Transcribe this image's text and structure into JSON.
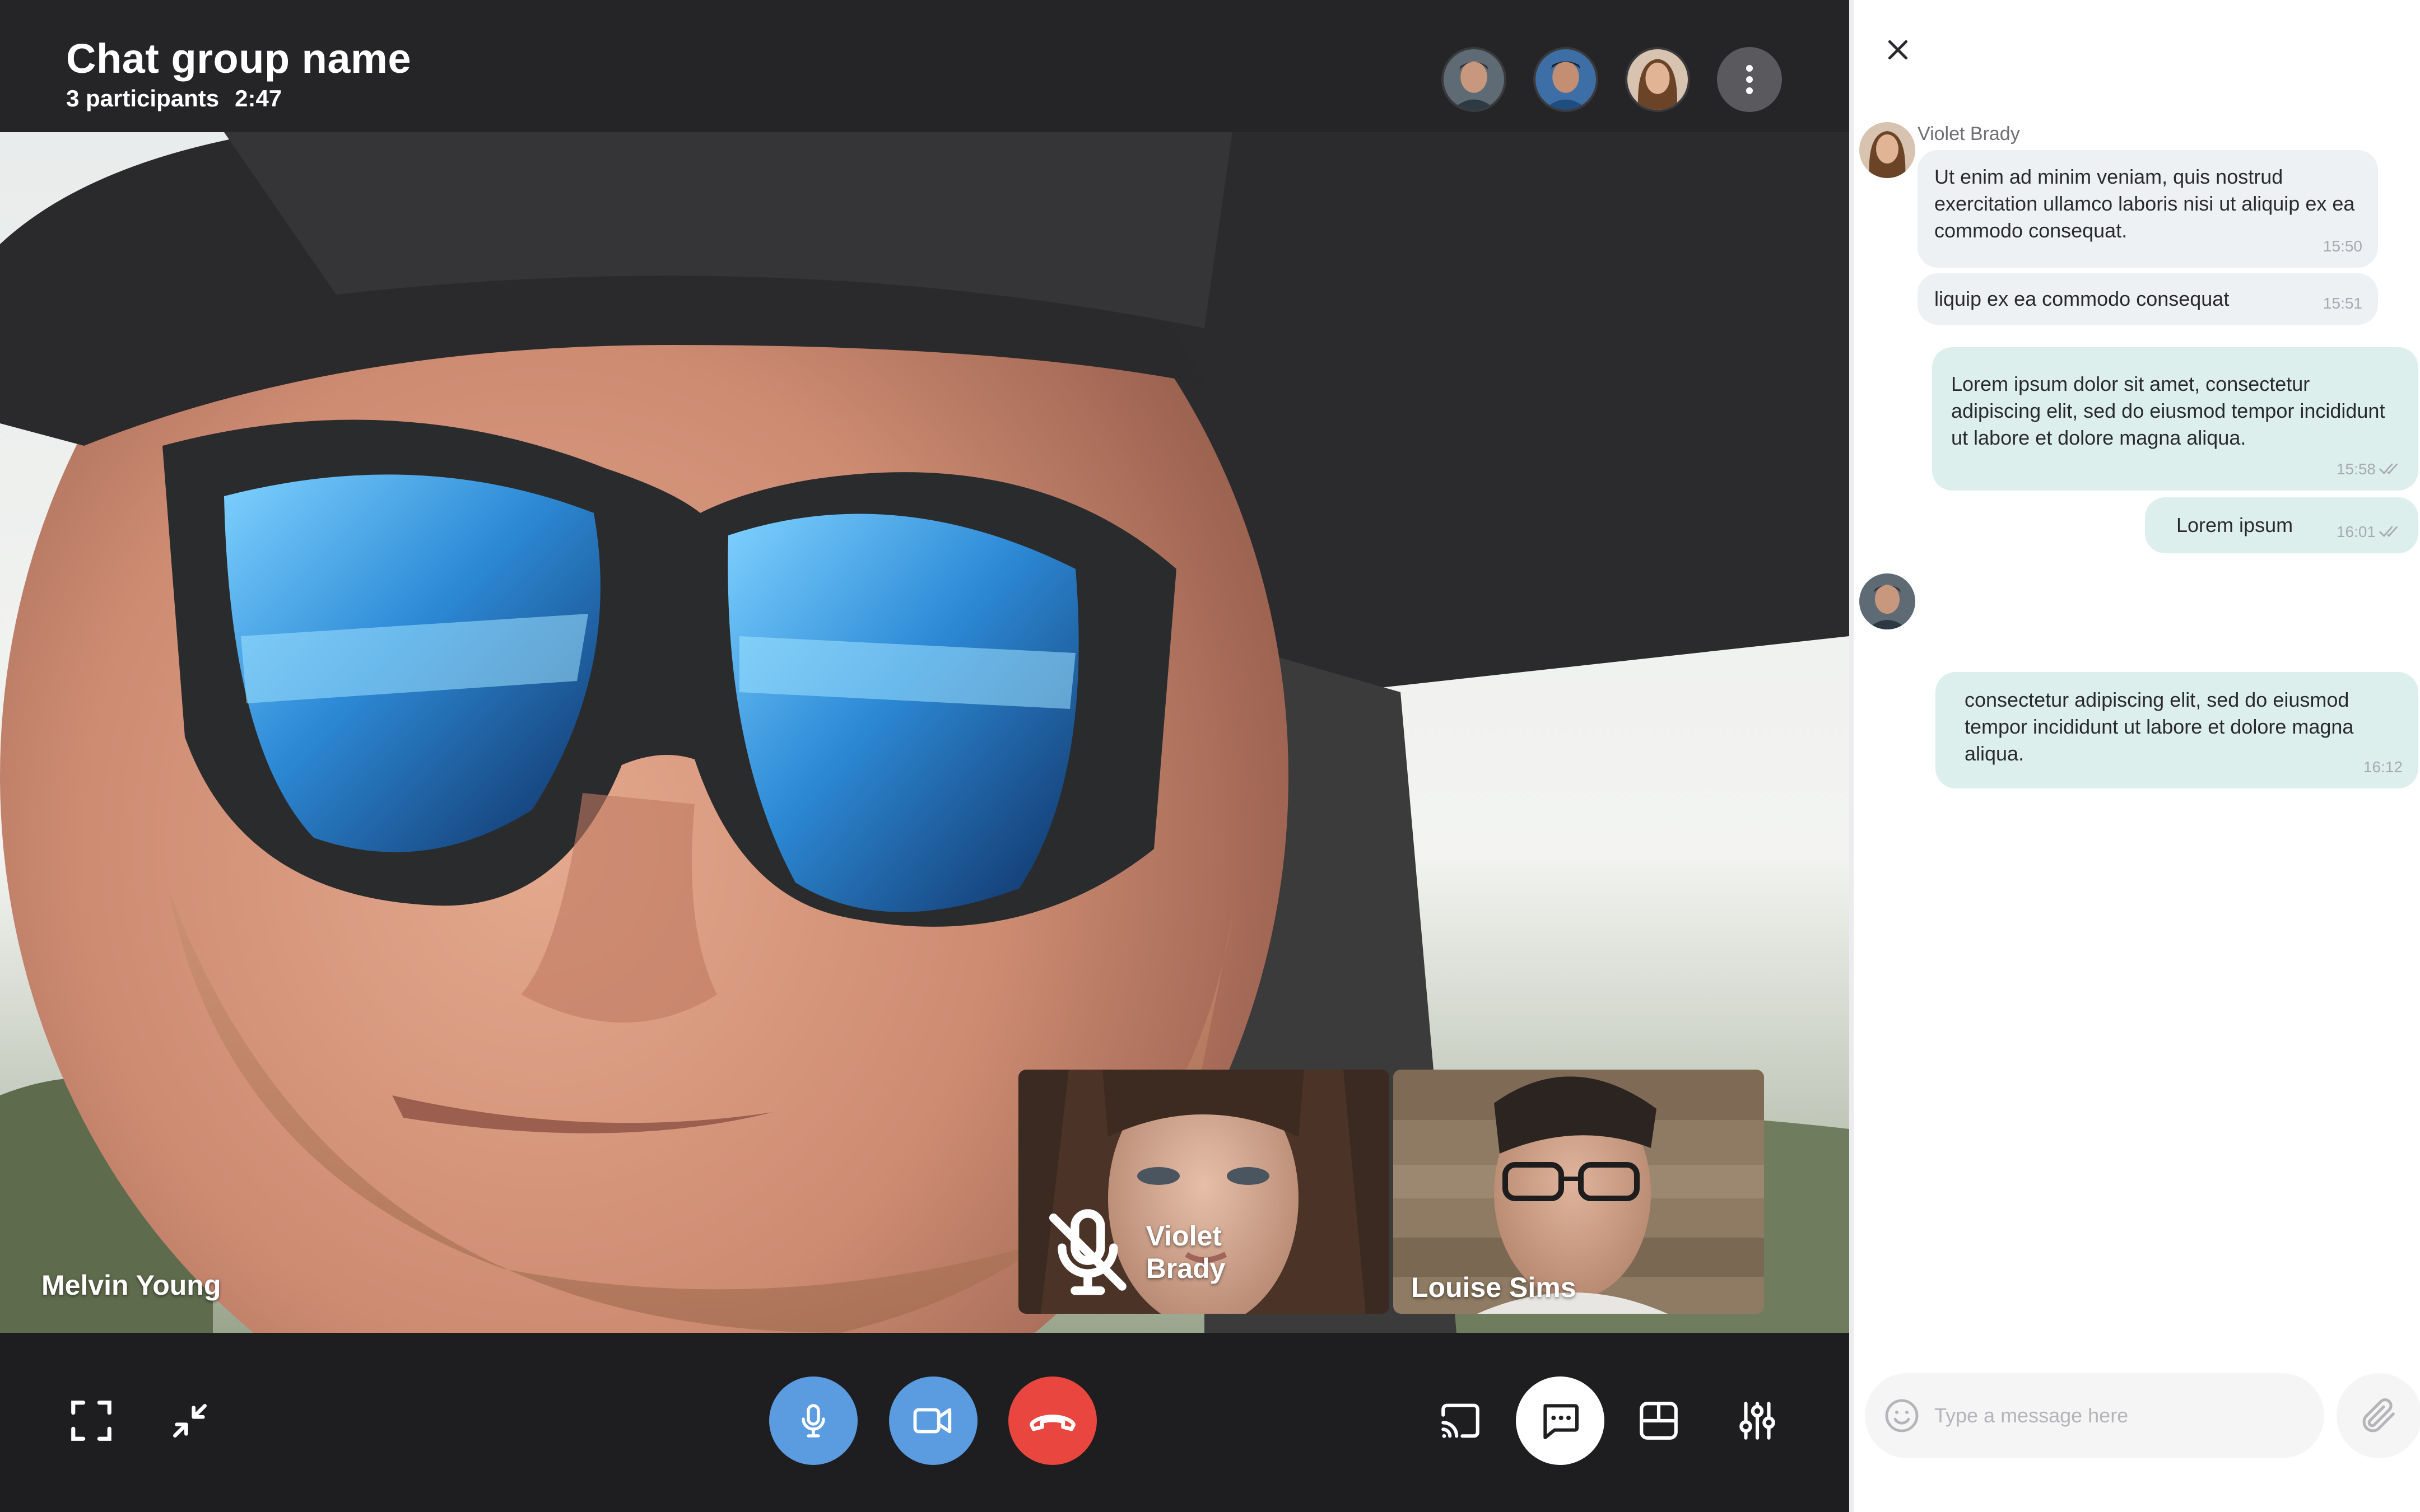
{
  "header": {
    "title": "Chat group name",
    "participants": "3 participants",
    "duration": "2:47"
  },
  "participants": [
    {
      "name": "Melvin Young",
      "role": "main-video"
    },
    {
      "name": "Violet Brady",
      "muted": true
    },
    {
      "name": "Louise Sims"
    }
  ],
  "controls": {
    "left": [
      "fullscreen-icon",
      "minimize-icon"
    ],
    "center": [
      "microphone-icon",
      "video-camera-icon",
      "hang-up-icon"
    ],
    "right": [
      "cast-icon",
      "chat-icon",
      "layout-icon",
      "settings-sliders-icon"
    ]
  },
  "chat": {
    "messages": [
      {
        "sender": "Violet Brady",
        "text": "Ut enim ad minim veniam, quis nostrud exercitation ullamco laboris nisi ut aliquip ex ea commodo consequat.",
        "time": "15:50",
        "direction": "in"
      },
      {
        "text": "liquip ex ea commodo consequat",
        "time": "15:51",
        "direction": "in"
      },
      {
        "text": "Lorem ipsum dolor sit amet, consectetur adipiscing elit, sed do eiusmod tempor incididunt ut labore et dolore magna aliqua.",
        "time": "15:58",
        "direction": "out",
        "read": true
      },
      {
        "text": "Lorem ipsum",
        "time": "16:01",
        "direction": "out",
        "read": true
      },
      {
        "text": "consectetur adipiscing elit, sed do eiusmod tempor incididunt ut labore et dolore magna aliqua.",
        "time": "16:12",
        "direction": "out"
      }
    ],
    "input_placeholder": "Type a message here"
  },
  "colors": {
    "accent_blue": "#5b9be0",
    "hangup_red": "#e9463f",
    "incoming_bubble": "#eef1f4",
    "outgoing_bubble": "#dcefec"
  }
}
